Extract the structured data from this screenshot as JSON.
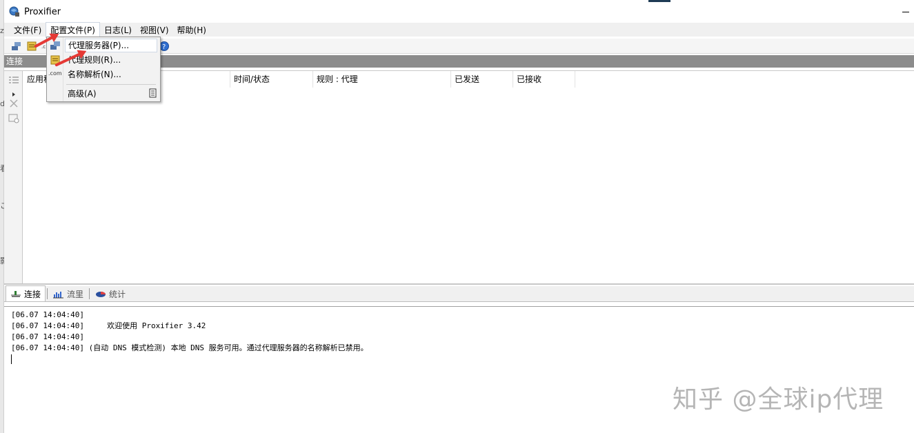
{
  "window": {
    "title": "Proxifier",
    "accent": "#8c8c8c"
  },
  "edge_fragments": [
    "z",
    "d",
    "看",
    "こ",
    "影"
  ],
  "menu": {
    "items": [
      "文件(F)",
      "配置文件(P)",
      "日志(L)",
      "视图(V)",
      "帮助(H)"
    ],
    "active_index": 1
  },
  "toolbar": {
    "icons": [
      "connections-icon",
      "rules-icon",
      "dns-icon",
      "servers-icon",
      "help-icon"
    ]
  },
  "connections": {
    "header": "连接",
    "columns": [
      "应用程",
      "",
      "时间/状态",
      "规则 : 代理",
      "已发送",
      "已接收"
    ]
  },
  "dropdown": {
    "items": [
      "代理服务器(P)...",
      "代理规则(R)...",
      "名称解析(N)...",
      "高级(A)"
    ],
    "dns_icon_label": ".com",
    "hover_index": 0
  },
  "tabs": {
    "items": [
      "连接",
      "流里",
      "统计"
    ],
    "selected_index": 0
  },
  "log": {
    "lines": [
      "[06.07 14:04:40]",
      "[06.07 14:04:40]     欢迎使用 Proxifier 3.42",
      "[06.07 14:04:40]",
      "[06.07 14:04:40] (自动 DNS 模式检测) 本地 DNS 服务可用。通过代理服务器的名称解析已禁用。"
    ]
  },
  "watermark": "知乎 @全球ip代理",
  "annotation_color": "#e53935"
}
